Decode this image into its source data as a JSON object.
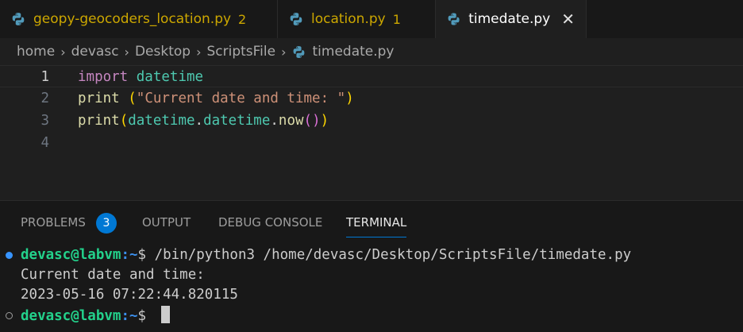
{
  "tabs": [
    {
      "name": "geopy-geocoders_location.py",
      "count": "2"
    },
    {
      "name": "location.py",
      "count": "1"
    },
    {
      "name": "timedate.py",
      "close": "✕"
    }
  ],
  "breadcrumb": {
    "items": [
      "home",
      "devasc",
      "Desktop",
      "ScriptsFile",
      "timedate.py"
    ],
    "separator": "›"
  },
  "editor": {
    "line_numbers": [
      "1",
      "2",
      "3",
      "4"
    ],
    "line1": {
      "kw": "import",
      "mod": "datetime"
    },
    "line2": {
      "fn": "print",
      "space": " ",
      "open": "(",
      "str": "\"Current date and time: \"",
      "close": ")"
    },
    "line3": {
      "fn": "print",
      "open": "(",
      "mod1": "datetime",
      "dot1": ".",
      "mod2": "datetime",
      "dot2": ".",
      "fn2": "now",
      "open2": "(",
      "close2": ")",
      "close": ")"
    }
  },
  "panel": {
    "tabs": [
      "PROBLEMS",
      "OUTPUT",
      "DEBUG CONSOLE",
      "TERMINAL"
    ],
    "problems_count": "3",
    "active_tab": "TERMINAL"
  },
  "terminal": {
    "user": "devasc@labvm",
    "path": ":~",
    "prompt_suffix": "$ ",
    "command": "/bin/python3 /home/devasc/Desktop/ScriptsFile/timedate.py",
    "output": [
      "Current date and time:",
      "2023-05-16 07:22:44.820115"
    ]
  },
  "colors": {
    "accent": "#0078d4",
    "warning": "#cca700",
    "prompt_user": "#23d18b",
    "prompt_path": "#3b8eea"
  }
}
